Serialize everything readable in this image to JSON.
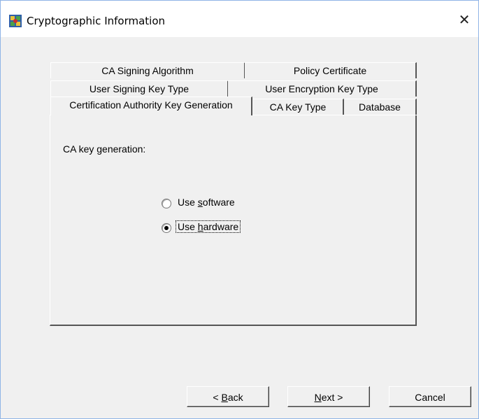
{
  "window": {
    "title": "Cryptographic Information",
    "close_label": "✕"
  },
  "tabs": {
    "row1": [
      {
        "label": "CA Signing Algorithm"
      },
      {
        "label": "Policy Certificate"
      }
    ],
    "row2": [
      {
        "label": "User Signing Key Type"
      },
      {
        "label": "User Encryption Key Type"
      }
    ],
    "row3": [
      {
        "label": "Certification Authority Key Generation",
        "selected": true
      },
      {
        "label": "CA Key Type"
      },
      {
        "label": "Database"
      }
    ]
  },
  "panel": {
    "heading": "CA key generation:",
    "options": [
      {
        "pre": "Use ",
        "accel": "s",
        "post": "oftware",
        "checked": false
      },
      {
        "pre": "Use ",
        "accel": "h",
        "post": "ardware",
        "checked": true
      }
    ]
  },
  "buttons": {
    "back": {
      "pre": "< ",
      "accel": "B",
      "post": "ack"
    },
    "next": {
      "accel": "N",
      "post": "ext >"
    },
    "cancel": {
      "label": "Cancel"
    }
  }
}
